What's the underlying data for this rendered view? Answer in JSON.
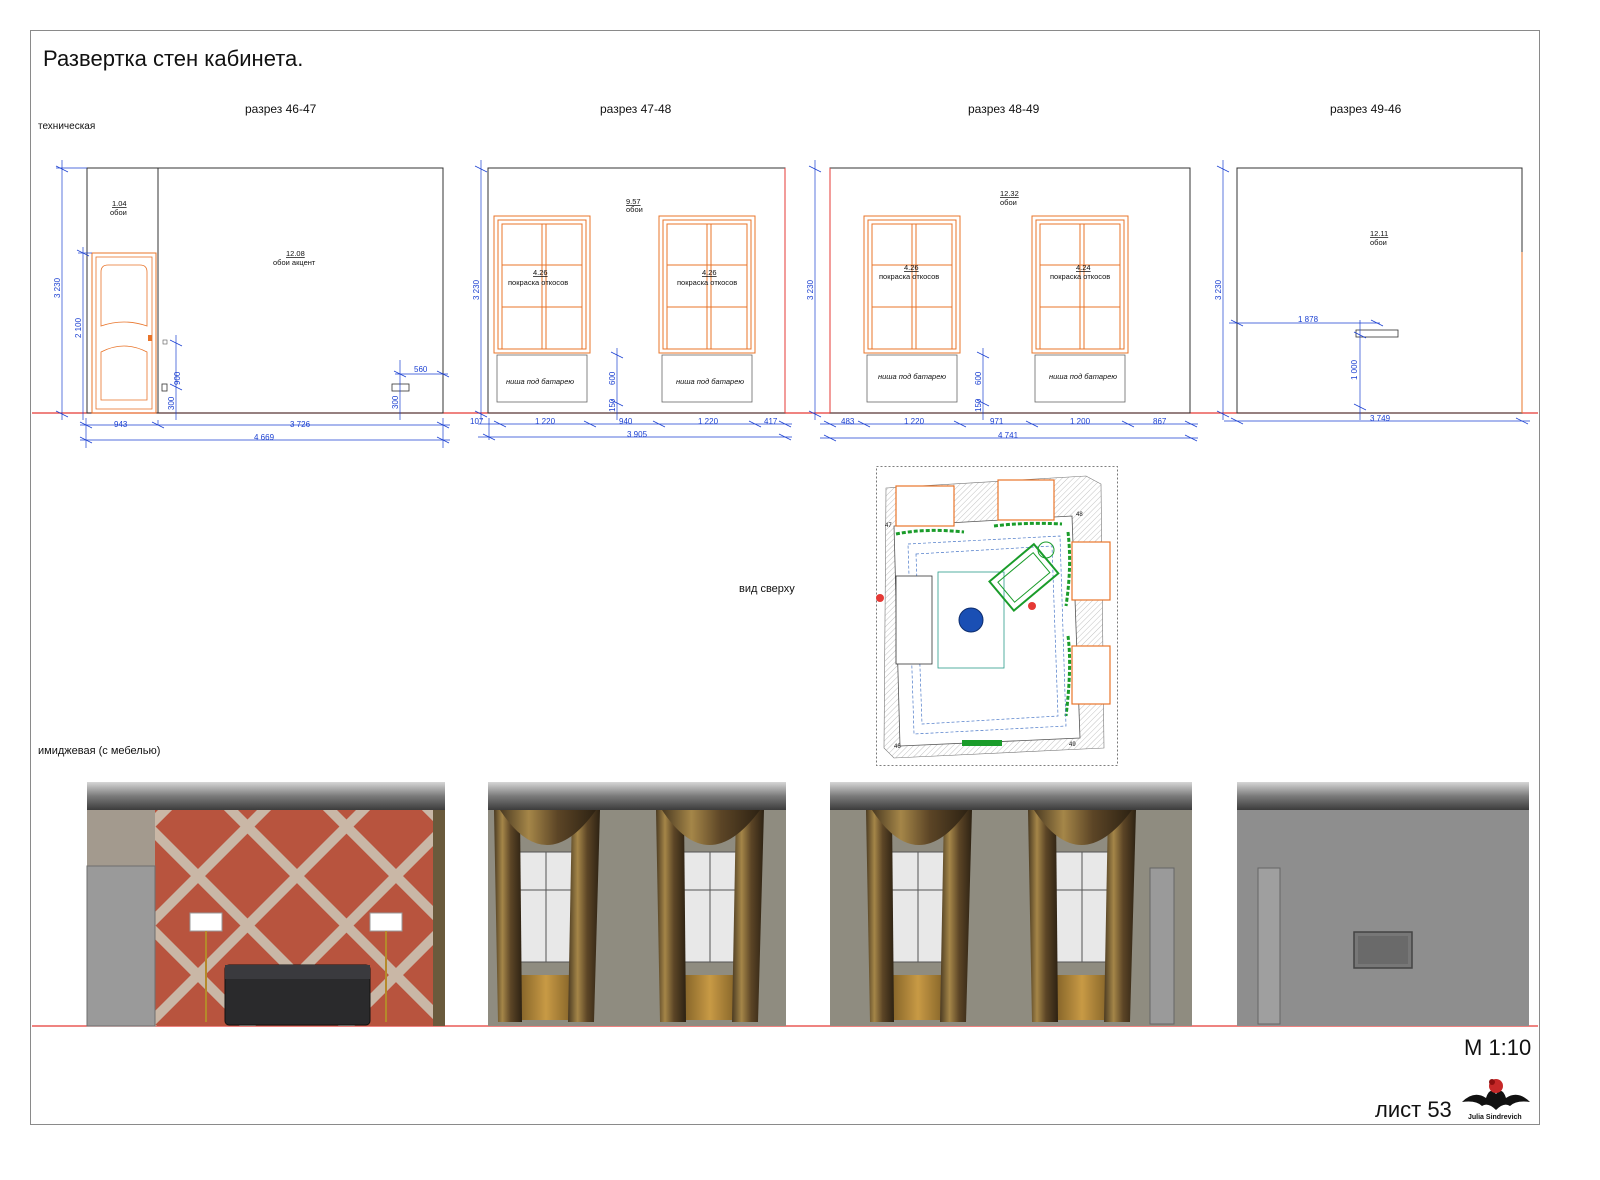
{
  "sheet": {
    "title": "Развертка стен кабинета.",
    "technical_label": "техническая",
    "image_label": "имиджевая (с мебелью)",
    "top_view_label": "вид сверху",
    "scale": "М 1:10",
    "sheet_number": "лист 53",
    "logo_text": "Julia Sindrevich"
  },
  "sections": [
    {
      "title": "разрез 46-47",
      "areas": [
        {
          "value": "1.04",
          "finish": "обои"
        },
        {
          "value": "12.08",
          "finish": "обои акцент"
        }
      ],
      "dims": {
        "height": "3 230",
        "door": "2 100",
        "socket": "900",
        "socket_low": "300",
        "switch_w": "560",
        "base1": "943",
        "base2": "3 726",
        "total": "4 669",
        "right_h": "300"
      }
    },
    {
      "title": "разрез 47-48",
      "areas": [
        {
          "value": "9.57",
          "finish": "обои"
        },
        {
          "value": "4.26",
          "finish": "покраска откосов"
        },
        {
          "value": "4.26",
          "finish": "покраска откосов"
        }
      ],
      "niche": "ниша под батарею",
      "dims": {
        "height": "3 230",
        "sill": "600",
        "sill_low": "150",
        "left": "107",
        "w1": "1 220",
        "mid": "940",
        "w2": "1 220",
        "right": "417",
        "total": "3 905"
      }
    },
    {
      "title": "разрез 48-49",
      "areas": [
        {
          "value": "12.32",
          "finish": "обои"
        },
        {
          "value": "4.26",
          "finish": "покраска откосов"
        },
        {
          "value": "4.24",
          "finish": "покраска откосов"
        }
      ],
      "niche": "ниша под батарею",
      "dims": {
        "height": "3 230",
        "sill": "600",
        "sill_low": "150",
        "left": "483",
        "w1": "1 220",
        "mid": "971",
        "w2": "1 200",
        "right": "867",
        "total": "4 741"
      }
    },
    {
      "title": "разрез 49-46",
      "areas": [
        {
          "value": "12.11",
          "finish": "обои"
        }
      ],
      "dims": {
        "height": "3 230",
        "tv_x": "1 878",
        "tv_h": "1 000",
        "total": "3 749"
      }
    }
  ],
  "plan_marks": {
    "n47": "47",
    "n48": "48",
    "n49": "49",
    "n46": "46"
  },
  "colors": {
    "frame": "#8a8a8a",
    "dimension": "#1a3fd1",
    "window": "#e8742a",
    "floor_line": "#e53935",
    "plan_furniture": "#1a9c2a"
  }
}
